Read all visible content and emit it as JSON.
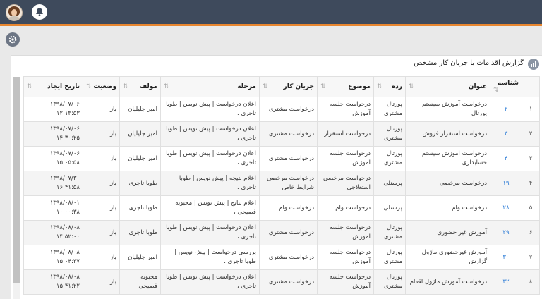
{
  "header": {
    "title": "گزارش اقدامات با جریان کار مشخص"
  },
  "columns": [
    "",
    "شناسه",
    "عنوان",
    "رده",
    "موضوع",
    "جریان کار",
    "مرحله",
    "مولف",
    "وضعیت",
    "تاریخ ایجاد"
  ],
  "rows": [
    [
      "۱",
      "۲",
      "درخواست آموزش سیستم پورتال",
      "پورتال مشتری",
      "درخواست جلسه آموزش",
      "درخواست مشتری",
      "اعلان درخواست | پیش نویس | طوبا تاجری ،",
      "امیر جلیلیان",
      "باز",
      "۱۳۹۸/۰۷/۰۶ ۱۲:۱۳:۵۳"
    ],
    [
      "۲",
      "۳",
      "درخواست استقرار فروش",
      "پورتال مشتری",
      "درخواست استقرار",
      "درخواست مشتری",
      "اعلان درخواست | پیش نویس | طوبا تاجری ،",
      "امیر جلیلیان",
      "باز",
      "۱۳۹۸/۰۷/۰۶ ۱۴:۳۰:۲۵"
    ],
    [
      "۳",
      "۴",
      "درخواست آموزش سیستم حسابداری",
      "پورتال مشتری",
      "درخواست جلسه آموزش",
      "درخواست مشتری",
      "اعلان درخواست | پیش نویس | طوبا تاجری ،",
      "امیر جلیلیان",
      "باز",
      "۱۳۹۸/۰۷/۰۶ ۱۵:۰۵:۵۸"
    ],
    [
      "۴",
      "۱۹",
      "درخواست مرخصی",
      "پرسنلی",
      "درخواست مرخصی استعلاجی",
      "درخواست مرخصی شرایط خاص",
      "اعلام نتیجه | پیش نویس | طوبا تاجری ،",
      "طوبا تاجری",
      "باز",
      "۱۳۹۸/۰۷/۳۰ ۱۶:۴۱:۵۸"
    ],
    [
      "۵",
      "۲۸",
      "درخواست وام",
      "پرسنلی",
      "درخواست وام",
      "درخواست وام",
      "اعلام نتایج | پیش نویس | محبوبه فصیحی ،",
      "طوبا تاجری",
      "باز",
      "۱۳۹۸/۰۸/۰۱ ۱۰:۰۰:۳۸"
    ],
    [
      "۶",
      "۲۹",
      "آموزش غیر حضوری",
      "پورتال مشتری",
      "درخواست جلسه آموزش",
      "درخواست مشتری",
      "اعلان درخواست | پیش نویس | طوبا تاجری ،",
      "طوبا تاجری",
      "باز",
      "۱۳۹۸/۰۸/۰۸ ۱۴:۵۲:۰۰"
    ],
    [
      "۷",
      "۳۰",
      "آموزش غیرحضوری ماژول گزارش",
      "پورتال مشتری",
      "درخواست جلسه آموزش",
      "درخواست مشتری",
      "بررسی درخواست | پیش نویس | طوبا تاجری ،",
      "امیر جلیلیان",
      "باز",
      "۱۳۹۸/۰۸/۰۸ ۱۵:۰۴:۳۷"
    ],
    [
      "۸",
      "۳۲",
      "درخواست آموزش ماژول اقدام",
      "پورتال مشتری",
      "درخواست جلسه آموزش",
      "درخواست مشتری",
      "اعلان درخواست | پیش نویس | طوبا تاجری ،",
      "محبوبه فصیحی",
      "باز",
      "۱۳۹۸/۰۸/۰۸ ۱۵:۴۱:۲۲"
    ]
  ],
  "colors": {
    "topbar": "#3e4a5c",
    "accent": "#e8862f",
    "link": "#2b7bd6"
  },
  "icons": {
    "avatar": "user-avatar",
    "bell": "bell-icon",
    "gear": "gear-icon",
    "report": "report-icon",
    "sort": "sort-icon"
  }
}
